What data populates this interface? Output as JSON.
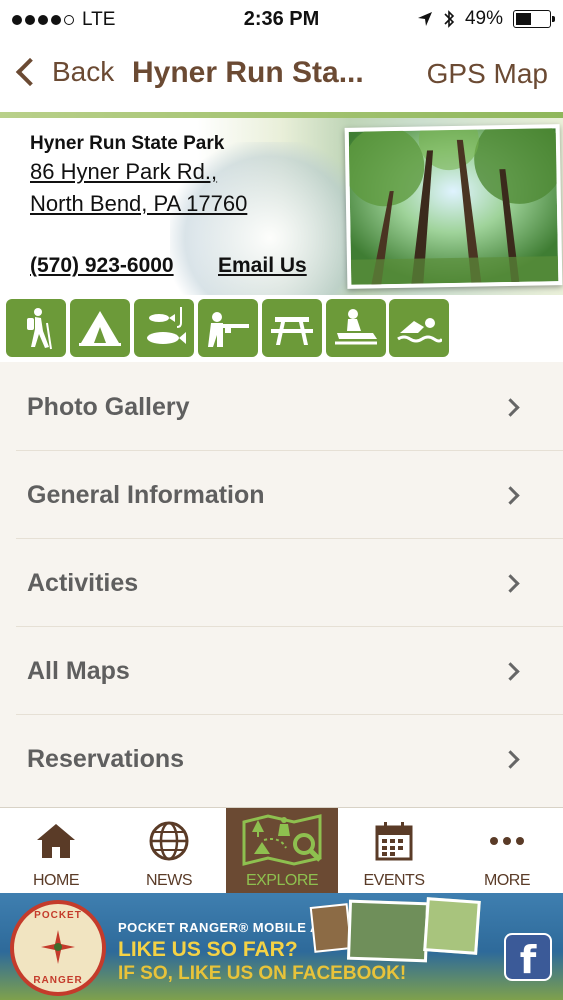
{
  "status_bar": {
    "carrier": "LTE",
    "time": "2:36 PM",
    "battery": "49%",
    "battery_level": 0.49
  },
  "nav": {
    "back_label": "Back",
    "title": "Hyner Run Sta...",
    "gps_label": "GPS Map"
  },
  "park": {
    "name": "Hyner Run State Park",
    "address_line1": "86 Hyner Park Rd.,",
    "address_line2": "North Bend, PA 17760",
    "phone": "(570) 923-6000",
    "email_label": "Email Us"
  },
  "activities": [
    {
      "icon": "hiking-icon"
    },
    {
      "icon": "camping-icon"
    },
    {
      "icon": "fishing-icon"
    },
    {
      "icon": "hunting-icon"
    },
    {
      "icon": "picnic-icon"
    },
    {
      "icon": "snowmobile-icon"
    },
    {
      "icon": "swimming-icon"
    }
  ],
  "menu": [
    {
      "label": "Photo Gallery"
    },
    {
      "label": "General Information"
    },
    {
      "label": "Activities"
    },
    {
      "label": "All Maps"
    },
    {
      "label": "Reservations"
    }
  ],
  "tabs": [
    {
      "label": "HOME",
      "icon": "home-icon",
      "active": false
    },
    {
      "label": "NEWS",
      "icon": "globe-icon",
      "active": false
    },
    {
      "label": "EXPLORE",
      "icon": "explore-map-icon",
      "active": true
    },
    {
      "label": "EVENTS",
      "icon": "calendar-icon",
      "active": false
    },
    {
      "label": "MORE",
      "icon": "more-dots-icon",
      "active": false
    }
  ],
  "ad": {
    "logo_top": "POCKET",
    "logo_bottom": "RANGER",
    "line1": "POCKET RANGER® MOBILE APP",
    "line2": "LIKE US SO FAR?",
    "line3": "IF SO, LIKE US ON FACEBOOK!"
  },
  "colors": {
    "brand_brown": "#6b4a33",
    "activity_green": "#6c9a39",
    "explore_green": "#8ec04f",
    "facebook_blue": "#3b5a98"
  }
}
